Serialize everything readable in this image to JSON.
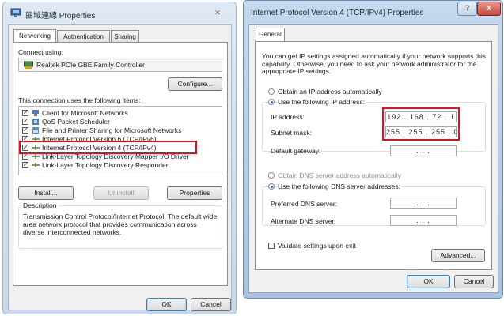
{
  "left_window": {
    "title": "區域連線 Properties",
    "tabs": [
      {
        "label": "Networking"
      },
      {
        "label": "Authentication"
      },
      {
        "label": "Sharing"
      }
    ],
    "connect_using_label": "Connect using:",
    "adapter_name": "Realtek PCIe GBE Family Controller",
    "configure_button": "Configure...",
    "items_label": "This connection uses the following items:",
    "items": [
      {
        "label": "Client for Microsoft Networks",
        "checked": true,
        "icon": "network-client-icon"
      },
      {
        "label": "QoS Packet Scheduler",
        "checked": true,
        "icon": "qos-icon"
      },
      {
        "label": "File and Printer Sharing for Microsoft Networks",
        "checked": true,
        "icon": "file-printer-icon"
      },
      {
        "label": "Internet Protocol Version 6 (TCP/IPv6)",
        "checked": true,
        "icon": "protocol-icon"
      },
      {
        "label": "Internet Protocol Version 4 (TCP/IPv4)",
        "checked": true,
        "icon": "protocol-icon",
        "highlighted": true
      },
      {
        "label": "Link-Layer Topology Discovery Mapper I/O Driver",
        "checked": true,
        "icon": "protocol-icon"
      },
      {
        "label": "Link-Layer Topology Discovery Responder",
        "checked": true,
        "icon": "protocol-icon"
      }
    ],
    "install_button": "Install...",
    "uninstall_button": "Uninstall",
    "properties_button": "Properties",
    "description_label": "Description",
    "description_text": "Transmission Control Protocol/Internet Protocol. The default wide area network protocol that provides communication across diverse interconnected networks.",
    "ok_button": "OK",
    "cancel_button": "Cancel"
  },
  "right_window": {
    "title": "Internet Protocol Version 4 (TCP/IPv4) Properties",
    "tab": "General",
    "intro_text": "You can get IP settings assigned automatically if your network supports this capability. Otherwise, you need to ask your network administrator for the appropriate IP settings.",
    "obtain_ip_auto": "Obtain an IP address automatically",
    "use_following_ip": "Use the following IP address:",
    "ip_label": "IP address:",
    "ip_value": "192 . 168 . 72 . 1",
    "subnet_label": "Subnet mask:",
    "subnet_value": "255 . 255 . 255 . 0",
    "gateway_label": "Default gateway:",
    "gateway_value": ".       .       .",
    "obtain_dns_auto": "Obtain DNS server address automatically",
    "use_following_dns": "Use the following DNS server addresses:",
    "preferred_dns_label": "Preferred DNS server:",
    "preferred_dns_value": ".       .       .",
    "alternate_dns_label": "Alternate DNS server:",
    "alternate_dns_value": ".       .       .",
    "validate_label": "Validate settings upon exit",
    "advanced_button": "Advanced...",
    "ok_button": "OK",
    "cancel_button": "Cancel",
    "help_glyph": "?",
    "close_glyph": "x"
  },
  "colors": {
    "highlight_box": "#e0101e",
    "title_bar": "#bcd0e6",
    "close_button": "#c8473b"
  }
}
